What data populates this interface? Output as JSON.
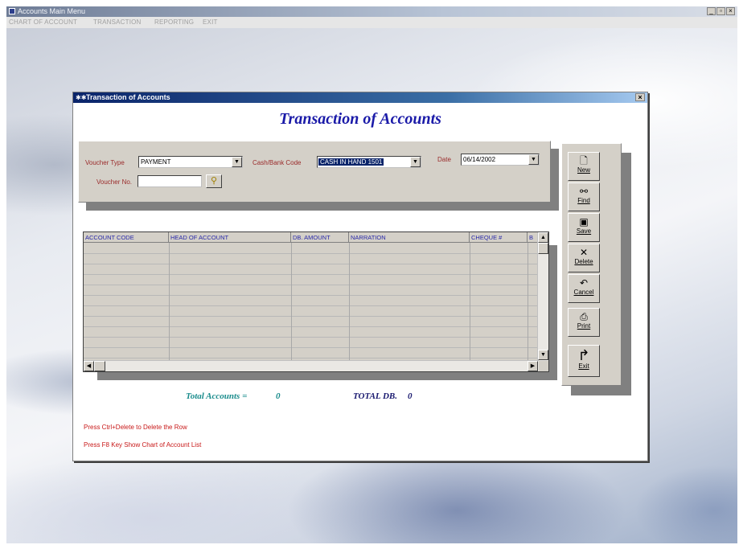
{
  "main_window": {
    "title": "Accounts Main Menu",
    "controls": {
      "minimize": "_",
      "maximize": "▫",
      "close": "×"
    }
  },
  "menubar": {
    "items": [
      "CHART OF ACCOUNT",
      "TRANSACTION",
      "REPORTING",
      "EXIT"
    ]
  },
  "dialog": {
    "title": "Transaction of Accounts",
    "close_label": "×",
    "heading": "Transaction of Accounts"
  },
  "voucher": {
    "type_label": "Voucher Type",
    "type_value": "PAYMENT",
    "cash_label": "Cash/Bank Code",
    "cash_value": "CASH IN HAND 1501",
    "date_label": "Date",
    "date_value": "06/14/2002",
    "no_label": "Voucher No.",
    "no_value": ""
  },
  "grid": {
    "columns": [
      "ACCOUNT CODE",
      "HEAD OF ACCOUNT",
      "DB. AMOUNT",
      "NARRATION",
      "CHEQUE #",
      "B"
    ]
  },
  "buttons": [
    {
      "label": "New",
      "icon": "new-document-icon"
    },
    {
      "label": "Find",
      "icon": "binoculars-icon"
    },
    {
      "label": "Save",
      "icon": "floppy-disk-icon"
    },
    {
      "label": "Delete",
      "icon": "delete-x-icon"
    },
    {
      "label": "Cancel",
      "icon": "undo-arrow-icon"
    },
    {
      "label": "Print",
      "icon": "printer-icon"
    },
    {
      "label": "Exit",
      "icon": "exit-arrow-icon"
    }
  ],
  "totals": {
    "accounts_label": "Total Accounts =",
    "accounts_value": "0",
    "db_label": "TOTAL DB.",
    "db_value": "0"
  },
  "hints": [
    "Press Ctrl+Delete to Delete the Row",
    "Press F8 Key Show Chart of Account List"
  ],
  "colors": {
    "heading": "#1a1aa8",
    "labels": "#9a2a2a",
    "hints": "#c81818",
    "total_accounts": "#1a8c8c",
    "total_db": "#1a1a70",
    "dialog_titlebar": "#0a246a"
  }
}
